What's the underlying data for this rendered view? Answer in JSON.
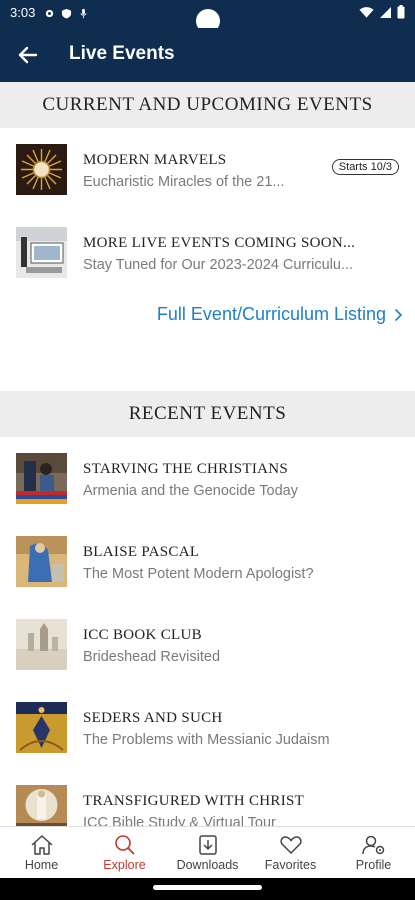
{
  "status": {
    "time": "3:03"
  },
  "header": {
    "title": "Live Events"
  },
  "sections": {
    "current_title": "CURRENT AND UPCOMING EVENTS",
    "recent_title": "RECENT EVENTS"
  },
  "current_events": [
    {
      "title": "MODERN MARVELS",
      "subtitle": "Eucharistic Miracles of the 21...",
      "badge": "Starts 10/3"
    },
    {
      "title": "MORE LIVE EVENTS COMING SOON...",
      "subtitle": "Stay Tuned for Our 2023-2024 Curriculu..."
    }
  ],
  "full_listing": {
    "label": "Full Event/Curriculum Listing"
  },
  "recent_events": [
    {
      "title": "STARVING THE CHRISTIANS",
      "subtitle": "Armenia and the Genocide Today"
    },
    {
      "title": "BLAISE PASCAL",
      "subtitle": "The Most Potent Modern Apologist?"
    },
    {
      "title": "ICC BOOK CLUB",
      "subtitle": "Brideshead Revisited"
    },
    {
      "title": "SEDERS AND SUCH",
      "subtitle": "The Problems with Messianic Judaism"
    },
    {
      "title": "TRANSFIGURED WITH CHRIST",
      "subtitle": "ICC Bible Study & Virtual Tour"
    }
  ],
  "nav": [
    {
      "label": "Home",
      "icon": "home-icon"
    },
    {
      "label": "Explore",
      "icon": "search-icon",
      "active": true
    },
    {
      "label": "Downloads",
      "icon": "download-icon"
    },
    {
      "label": "Favorites",
      "icon": "heart-icon"
    },
    {
      "label": "Profile",
      "icon": "profile-settings-icon"
    }
  ],
  "colors": {
    "header_bg": "#0f2d4f",
    "link": "#1f7fc9",
    "active_nav": "#c23a2a",
    "section_bg": "#ededed"
  }
}
